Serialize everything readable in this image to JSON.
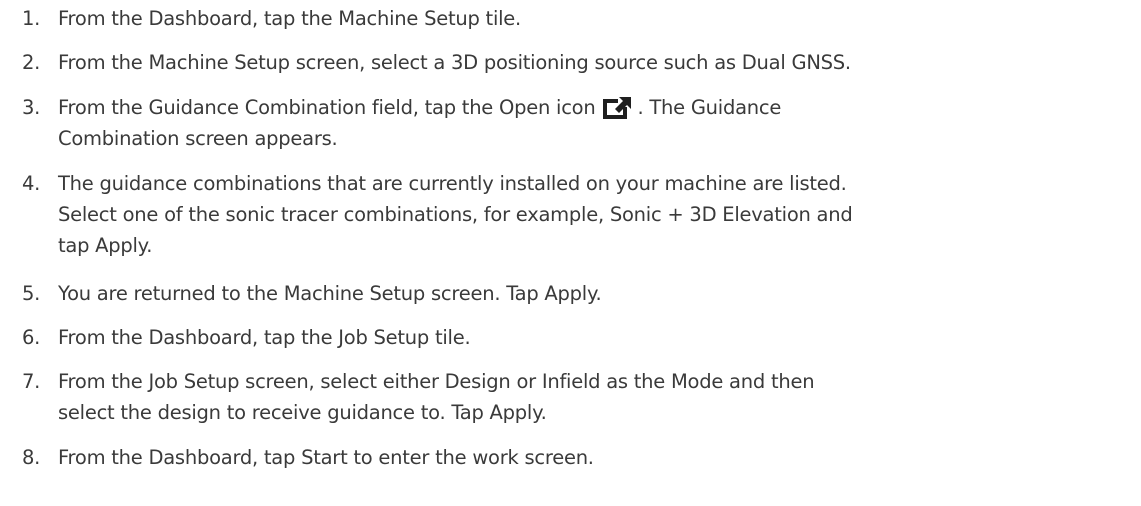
{
  "steps": [
    {
      "number": "1.",
      "lines": [
        "From the Dashboard, tap the Machine Setup tile."
      ]
    },
    {
      "number": "2.",
      "lines": [
        "From the Machine Setup screen, select a 3D positioning source such as Dual GNSS."
      ]
    },
    {
      "number": "3.",
      "line1_before_icon": "From the Guidance Combination field, tap the Open icon",
      "line1_after_icon": ". The Guidance",
      "line2": "Combination screen appears.",
      "icon": "open-icon"
    },
    {
      "number": "4.",
      "lines": [
        "The guidance combinations that are currently installed on your machine are listed.",
        "Select one of the sonic tracer combinations, for example, Sonic + 3D Elevation and",
        "tap Apply."
      ]
    },
    {
      "number": "5.",
      "lines": [
        "You are returned to the Machine Setup screen. Tap Apply."
      ]
    },
    {
      "number": "6.",
      "lines": [
        "From the Dashboard, tap the Job Setup tile."
      ]
    },
    {
      "number": "7.",
      "lines": [
        "From the Job Setup screen, select either Design or Infield as the Mode and then",
        "select the design to receive guidance to. Tap Apply."
      ]
    },
    {
      "number": "8.",
      "lines": [
        "From the Dashboard, tap Start to enter the work screen."
      ]
    }
  ]
}
